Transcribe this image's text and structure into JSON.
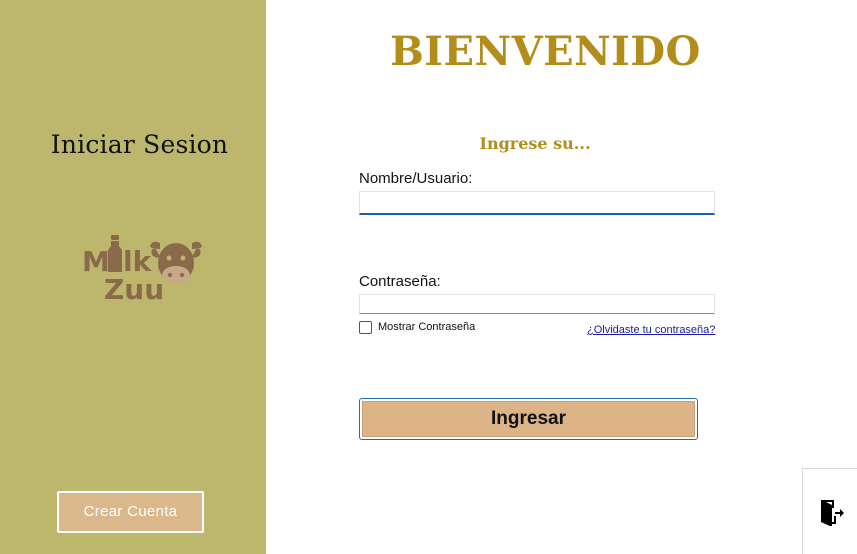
{
  "sidebar": {
    "title": "Iniciar Sesion",
    "logo": {
      "line1": "Milk",
      "line2": "Zuu",
      "icon": "cow-icon",
      "color": "#8a6a4a"
    },
    "create_account_label": "Crear Cuenta",
    "background": "#bcb76c"
  },
  "main": {
    "welcome": "BIENVENIDO",
    "subtitle": "Ingrese su...",
    "username": {
      "label": "Nombre/Usuario:",
      "value": ""
    },
    "password": {
      "label": "Contraseña:",
      "value": ""
    },
    "show_password_label": "Mostrar Contraseña",
    "show_password_checked": false,
    "forgot_password_label": "¿Olvidaste tu contraseña?",
    "login_label": "Ingresar",
    "exit_icon": "exit-door-icon"
  },
  "colors": {
    "accent_gold": "#b38d1a",
    "button_tan": "#dcb488",
    "focus_blue": "#1a5fa8"
  }
}
